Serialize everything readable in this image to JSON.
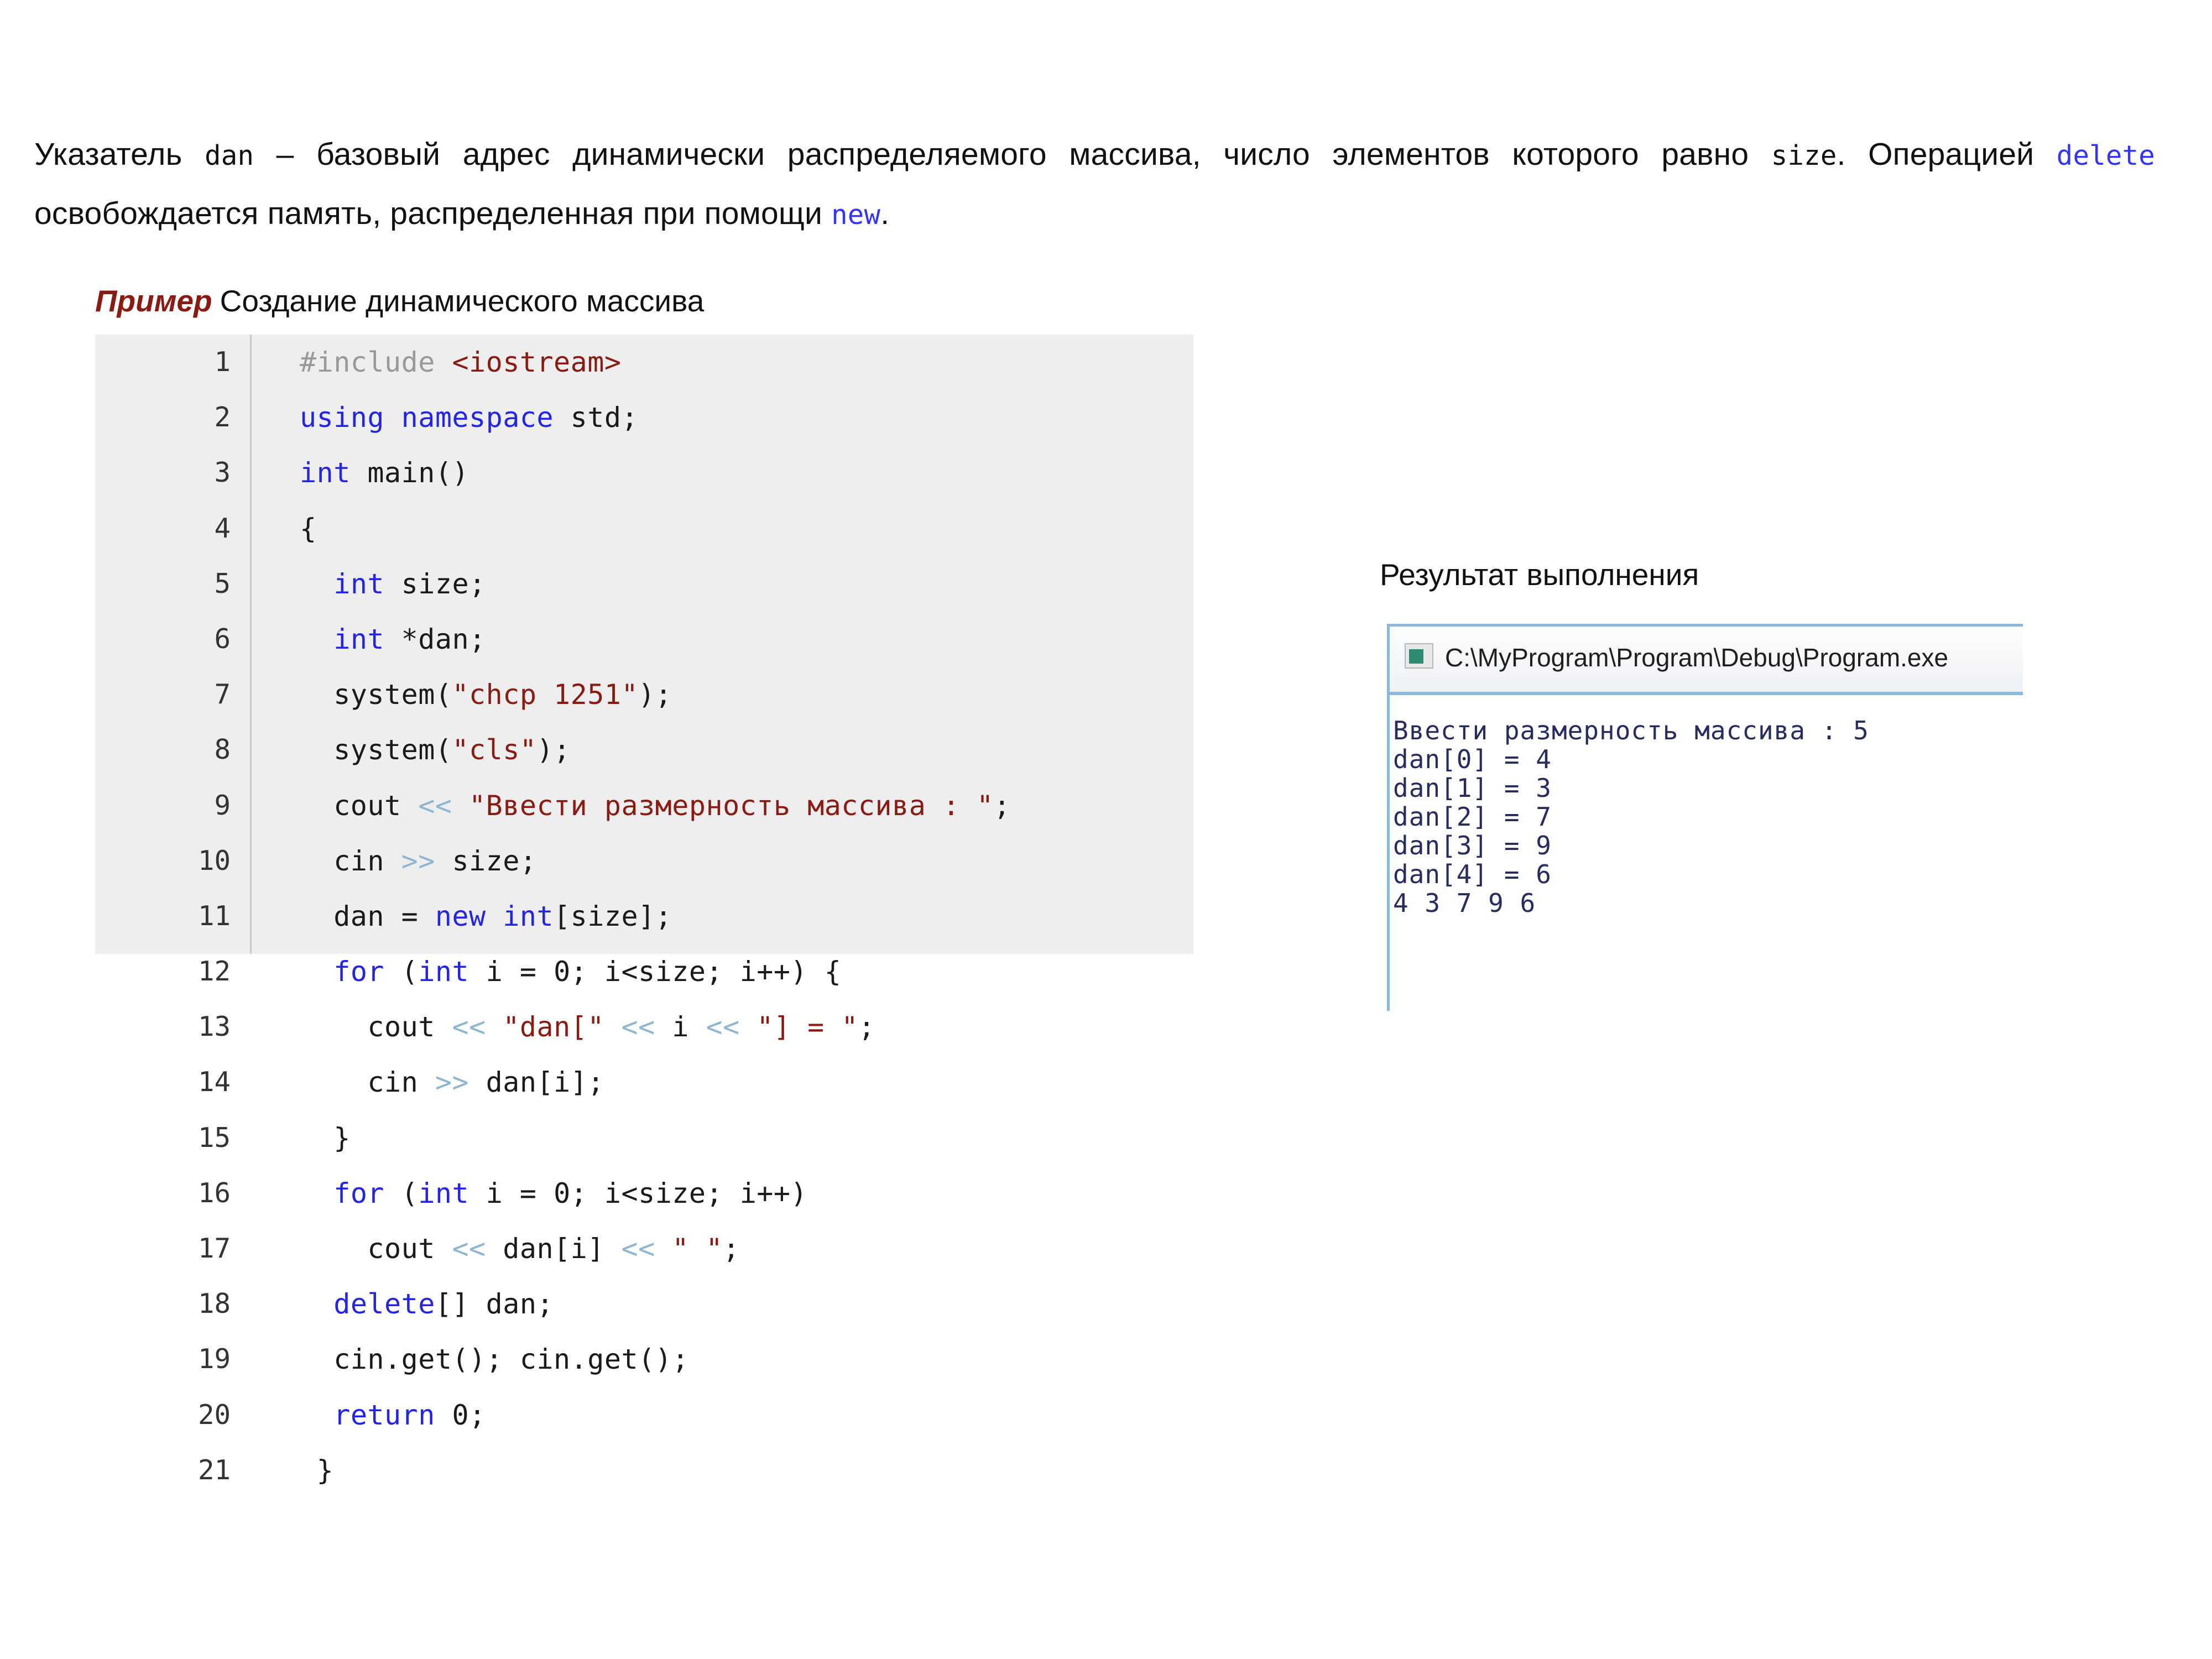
{
  "intro": {
    "seg1": "Указатель ",
    "code1": "dan",
    "seg2": " – базовый адрес динамически распределяемого массива, число элементов которого равно ",
    "code2": "size",
    "seg3": ". Операцией ",
    "kw1": "delete",
    "seg4": " освобождается память, распределенная при помощи ",
    "kw2": "new",
    "seg5": "."
  },
  "example": {
    "label": "Пример",
    "caption": "Создание динамического массива"
  },
  "code": {
    "language": "cpp",
    "line_numbers": [
      "1",
      "2",
      "3",
      "4",
      "5",
      "6",
      "7",
      "8",
      "9",
      "10",
      "11",
      "12",
      "13",
      "14",
      "15",
      "16",
      "17",
      "18",
      "19",
      "20",
      "21"
    ],
    "lines": [
      "#include <iostream>",
      "using namespace std;",
      "int main()",
      "{",
      "  int size;",
      "  int *dan;",
      "  system(\"chcp 1251\");",
      "  system(\"cls\");",
      "  cout << \"Ввести размерность массива : \";",
      "  cin >> size;",
      "  dan = new int[size];",
      "  for (int i = 0; i<size; i++) {",
      "    cout << \"dan[\" << i << \"] = \";",
      "    cin >> dan[i];",
      "  }",
      "  for (int i = 0; i<size; i++)",
      "    cout << dan[i] << \" \";",
      "  delete[] dan;",
      "  cin.get(); cin.get();",
      "  return 0;",
      "}"
    ]
  },
  "result": {
    "title": "Результат выполнения",
    "window_title": "C:\\MyProgram\\Program\\Debug\\Program.exe",
    "output_lines": [
      "Ввести размерность массива : 5",
      "dan[0] = 4",
      "dan[1] = 3",
      "dan[2] = 7",
      "dan[3] = 9",
      "dan[4] = 6",
      "4 3 7 9 6"
    ]
  },
  "colors": {
    "keyword": "#2424e8",
    "string": "#8b1a13",
    "preprocessor": "#999999",
    "stream_operator": "#8fb6d0",
    "example_label": "#8b1a13",
    "code_background": "#eeeeee",
    "console_border": "#8fb8d8",
    "console_text": "#262c5e"
  }
}
